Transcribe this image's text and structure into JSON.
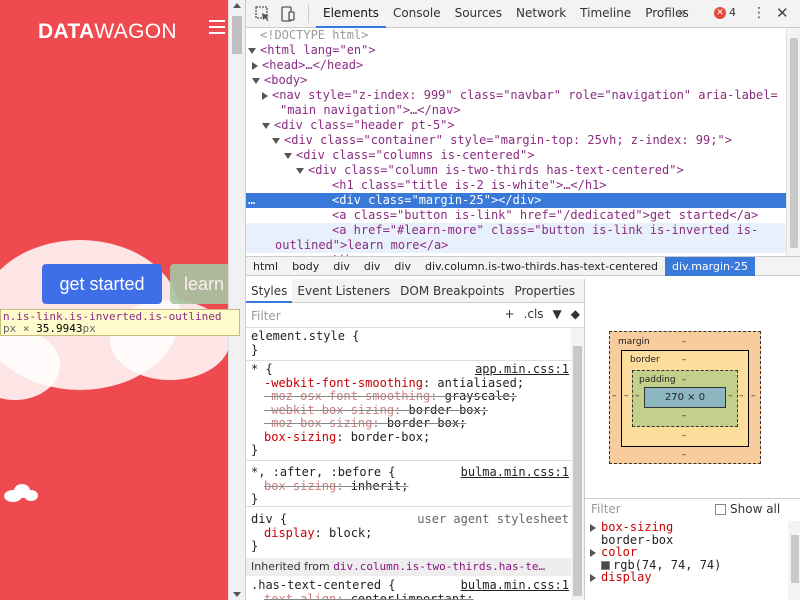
{
  "site": {
    "brand_bold": "DATA",
    "brand_light": "WAGON",
    "get_started": "get started",
    "learn_more": "learn",
    "tooltip_selector": "n.is-link.is-inverted.is-outlined",
    "tooltip_dims_prefix": "px",
    "tooltip_dims_x": " × ",
    "tooltip_dims_value": "35.9943",
    "tooltip_dims_suffix": "px",
    "background_color": "#ef4a4f",
    "button_color": "#3e6ee8"
  },
  "devtools": {
    "tabs": [
      "Elements",
      "Console",
      "Sources",
      "Network",
      "Timeline",
      "Profiles"
    ],
    "more": "»",
    "error_count": "4",
    "dom": [
      {
        "depth": 0,
        "html": "<!DOCTYPE html>"
      },
      {
        "depth": 0,
        "html": "<html lang=\"en\">"
      },
      {
        "depth": 1,
        "html": "<head>…</head>"
      },
      {
        "depth": 1,
        "html": "<body>"
      },
      {
        "depth": 2,
        "html": "<nav style=\"z-index: 999\" class=\"navbar\" role=\"navigation\" aria-label="
      },
      {
        "depth": 2,
        "html": "\"main navigation\">…</nav>"
      },
      {
        "depth": 2,
        "html": "<div class=\"header pt-5\">"
      },
      {
        "depth": 3,
        "html": "<div class=\"container\" style=\"margin-top: 25vh; z-index: 99;\">"
      },
      {
        "depth": 4,
        "html": "<div class=\"columns is-centered\">"
      },
      {
        "depth": 5,
        "html": "<div class=\"column is-two-thirds has-text-centered\">"
      },
      {
        "depth": 6,
        "html": "<h1 class=\"title is-2 is-white\">…</h1>"
      },
      {
        "depth": 6,
        "html": "<div class=\"margin-25\"></div>"
      },
      {
        "depth": 6,
        "html": "<a class=\"button is-link\" href=\"/dedicated\">get started</a>"
      },
      {
        "depth": 6,
        "html": "<a href=\"#learn-more\" class=\"button is-link is-inverted is-"
      },
      {
        "depth": 6,
        "html": "outlined\">learn more</a>"
      },
      {
        "depth": 5,
        "html": "</div>"
      }
    ],
    "breadcrumbs": [
      "html",
      "body",
      "div",
      "div",
      "div",
      "div.column.is-two-thirds.has-text-centered",
      "div.margin-25"
    ],
    "styles_tabs": [
      "Styles",
      "Event Listeners",
      "DOM Breakpoints",
      "Properties"
    ],
    "filter_placeholder": "Filter",
    "filter_tools": [
      "+",
      ".cls",
      "📌",
      "◆"
    ],
    "rules": {
      "element_style": "element.style {",
      "universal": {
        "selector": "* {",
        "source": "app.min.css:1",
        "props": [
          {
            "name": "-webkit-font-smoothing",
            "value": "antialiased;",
            "struck": false
          },
          {
            "name": "-moz-osx-font-smoothing",
            "value": "grayscale;",
            "struck": true
          },
          {
            "name": "-webkit-box-sizing",
            "value": "border-box;",
            "struck": true
          },
          {
            "name": "-moz-box-sizing",
            "value": "border-box;",
            "struck": true
          },
          {
            "name": "box-sizing",
            "value": "border-box;",
            "struck": false
          }
        ]
      },
      "pseudo": {
        "selector": "*, :after, :before {",
        "source": "bulma.min.css:1",
        "props": [
          {
            "name": "box-sizing",
            "value": "inherit;",
            "struck": true
          }
        ]
      },
      "div_rule": {
        "selector": "div {",
        "source": "user agent stylesheet",
        "props": [
          {
            "name": "display",
            "value": "block;",
            "struck": false
          }
        ]
      },
      "inherited_label": "Inherited from",
      "inherited_node": "div.column.is-two-thirds.has-te…",
      "centered": {
        "selector": ".has-text-centered {",
        "source": "bulma.min.css:1",
        "props": [
          {
            "name": "text-align",
            "value": "center!important;",
            "struck": true
          }
        ]
      },
      "close": "}"
    },
    "box_model": {
      "margin": "margin",
      "border": "border",
      "padding": "padding",
      "dash": "–",
      "content": "270 × 0"
    },
    "computed_filter": "Filter",
    "show_all": "Show all",
    "computed": [
      {
        "name": "box-sizing",
        "value": "border-box"
      },
      {
        "name": "color",
        "value": "rgb(74, 74, 74)",
        "swatch": "#4a4a4a"
      },
      {
        "name": "display",
        "value": ""
      }
    ]
  }
}
